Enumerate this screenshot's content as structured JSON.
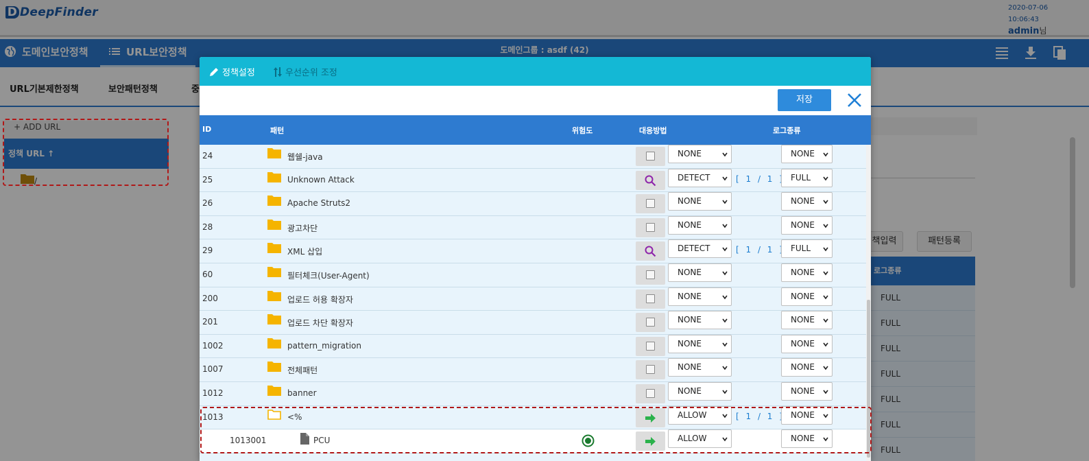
{
  "app": {
    "logo_text": "DeepFinder",
    "date": "2020-07-06",
    "time": "10:06:43",
    "user": "admin",
    "user_suffix": "님"
  },
  "nav": {
    "items": [
      {
        "label": "도메인보안정책",
        "icon": "globe-icon",
        "active": false
      },
      {
        "label": "URL보안정책",
        "icon": "list-icon",
        "active": true
      }
    ],
    "domain_group": "도메인그룹 : asdf (42)",
    "right_icons": [
      "list-lines-icon",
      "download-icon",
      "copy-icon"
    ]
  },
  "subnav": {
    "items": [
      "URL기본제한정책",
      "보안패턴정책",
      "중"
    ]
  },
  "tree": {
    "add_url": "+ ADD URL",
    "policy_url": "정책 URL",
    "root_folder": "/"
  },
  "background": {
    "buttons": [
      "책입력",
      "패턴등록"
    ],
    "table_header": "로그종류",
    "table_values": [
      "FULL",
      "FULL",
      "FULL",
      "FULL",
      "FULL",
      "FULL",
      "FULL"
    ]
  },
  "modal": {
    "tabs": [
      {
        "label": "정책설정",
        "icon": "pencil-icon",
        "active": true
      },
      {
        "label": "우선순위 조정",
        "icon": "sort-arrows-icon",
        "active": false
      }
    ],
    "save_label": "저장",
    "columns": {
      "id": "ID",
      "pattern": "패턴",
      "risk": "위험도",
      "action": "대응방법",
      "log": "로그종류"
    },
    "rows": [
      {
        "id": "24",
        "name": "웹쉘-java",
        "icon": "checkbox",
        "action": "NONE",
        "frac": "",
        "log": "NONE"
      },
      {
        "id": "25",
        "name": "Unknown Attack",
        "icon": "search",
        "action": "DETECT",
        "frac": "[ 1 / 1 ]",
        "log": "FULL"
      },
      {
        "id": "26",
        "name": "Apache Struts2",
        "icon": "checkbox",
        "action": "NONE",
        "frac": "",
        "log": "NONE"
      },
      {
        "id": "28",
        "name": "광고차단",
        "icon": "checkbox",
        "action": "NONE",
        "frac": "",
        "log": "NONE"
      },
      {
        "id": "29",
        "name": "XML 삽입",
        "icon": "search",
        "action": "DETECT",
        "frac": "[ 1 / 1 ]",
        "log": "FULL"
      },
      {
        "id": "60",
        "name": "필터체크(User-Agent)",
        "icon": "checkbox",
        "action": "NONE",
        "frac": "",
        "log": "NONE"
      },
      {
        "id": "200",
        "name": "업로드 허용 확장자",
        "icon": "checkbox",
        "action": "NONE",
        "frac": "",
        "log": "NONE"
      },
      {
        "id": "201",
        "name": "업로드 차단 확장자",
        "icon": "checkbox",
        "action": "NONE",
        "frac": "",
        "log": "NONE"
      },
      {
        "id": "1002",
        "name": "pattern_migration",
        "icon": "checkbox",
        "action": "NONE",
        "frac": "",
        "log": "NONE"
      },
      {
        "id": "1007",
        "name": "전체패턴",
        "icon": "checkbox",
        "action": "NONE",
        "frac": "",
        "log": "NONE"
      },
      {
        "id": "1012",
        "name": "banner",
        "icon": "checkbox",
        "action": "NONE",
        "frac": "",
        "log": "NONE"
      },
      {
        "id": "1013",
        "name": "<%",
        "icon": "arrow",
        "action": "ALLOW",
        "frac": "[ 1 / 1 ]",
        "log": "NONE"
      },
      {
        "id": "1013001",
        "name": "PCU",
        "icon": "arrow",
        "action": "ALLOW",
        "frac": "",
        "log": "NONE",
        "child": true
      }
    ]
  },
  "colors": {
    "nav_blue": "#2e7bd0",
    "modal_tab_cyan": "#14b8d5",
    "row_bg": "#e8f4fc",
    "highlight_dash": "#b01818",
    "folder_yellow": "#f5b400",
    "allow_green": "#2bb24c",
    "search_purple": "#8e24aa"
  }
}
